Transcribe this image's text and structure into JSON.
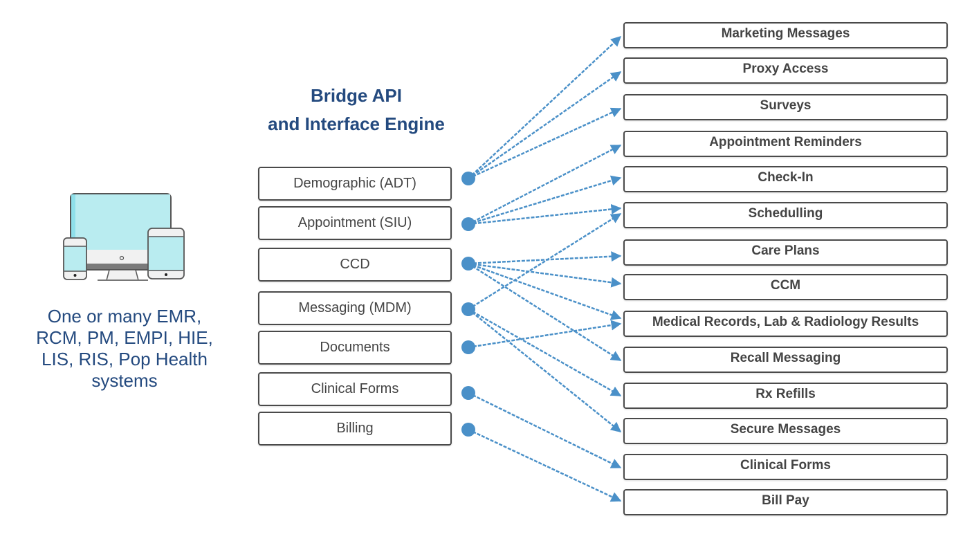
{
  "title": {
    "line1": "Bridge API",
    "line2": "and Interface Engine"
  },
  "source_caption": {
    "lines": [
      "One or many EMR,",
      "RCM, PM, EMPI, HIE,",
      "LIS, RIS, Pop Health",
      "systems"
    ],
    "icon": "devices-icon"
  },
  "colors": {
    "title": "#244a7f",
    "connector": "#4a90c8",
    "box_border": "#4a4a4a",
    "screen": "#b9ecf0"
  },
  "inputs": [
    {
      "id": "demographic",
      "label": "Demographic (ADT)"
    },
    {
      "id": "appointment",
      "label": "Appointment (SIU)"
    },
    {
      "id": "ccd",
      "label": "CCD"
    },
    {
      "id": "messaging",
      "label": "Messaging (MDM)"
    },
    {
      "id": "documents",
      "label": "Documents"
    },
    {
      "id": "clinical_forms",
      "label": "Clinical Forms"
    },
    {
      "id": "billing",
      "label": "Billing"
    }
  ],
  "outputs": [
    {
      "id": "marketing",
      "label": "Marketing Messages"
    },
    {
      "id": "proxy",
      "label": "Proxy Access"
    },
    {
      "id": "surveys",
      "label": "Surveys"
    },
    {
      "id": "appt_reminders",
      "label": "Appointment Reminders"
    },
    {
      "id": "checkin",
      "label": "Check-In"
    },
    {
      "id": "scheduling",
      "label": "Schedulling"
    },
    {
      "id": "care_plans",
      "label": "Care Plans"
    },
    {
      "id": "ccm",
      "label": "CCM"
    },
    {
      "id": "medical_records",
      "label": "Medical Records, Lab & Radiology Results"
    },
    {
      "id": "recall",
      "label": "Recall Messaging"
    },
    {
      "id": "rx",
      "label": "Rx Refills"
    },
    {
      "id": "secure",
      "label": "Secure Messages"
    },
    {
      "id": "out_clinical_forms",
      "label": "Clinical Forms"
    },
    {
      "id": "bill_pay",
      "label": "Bill Pay"
    }
  ],
  "connections": [
    {
      "from": "demographic",
      "to": "marketing"
    },
    {
      "from": "demographic",
      "to": "proxy"
    },
    {
      "from": "demographic",
      "to": "surveys"
    },
    {
      "from": "appointment",
      "to": "appt_reminders"
    },
    {
      "from": "appointment",
      "to": "checkin"
    },
    {
      "from": "appointment",
      "to": "scheduling"
    },
    {
      "from": "ccd",
      "to": "care_plans"
    },
    {
      "from": "ccd",
      "to": "ccm"
    },
    {
      "from": "ccd",
      "to": "medical_records"
    },
    {
      "from": "ccd",
      "to": "recall"
    },
    {
      "from": "messaging",
      "to": "scheduling"
    },
    {
      "from": "messaging",
      "to": "rx"
    },
    {
      "from": "messaging",
      "to": "secure"
    },
    {
      "from": "documents",
      "to": "medical_records"
    },
    {
      "from": "clinical_forms",
      "to": "out_clinical_forms"
    },
    {
      "from": "billing",
      "to": "bill_pay"
    }
  ]
}
